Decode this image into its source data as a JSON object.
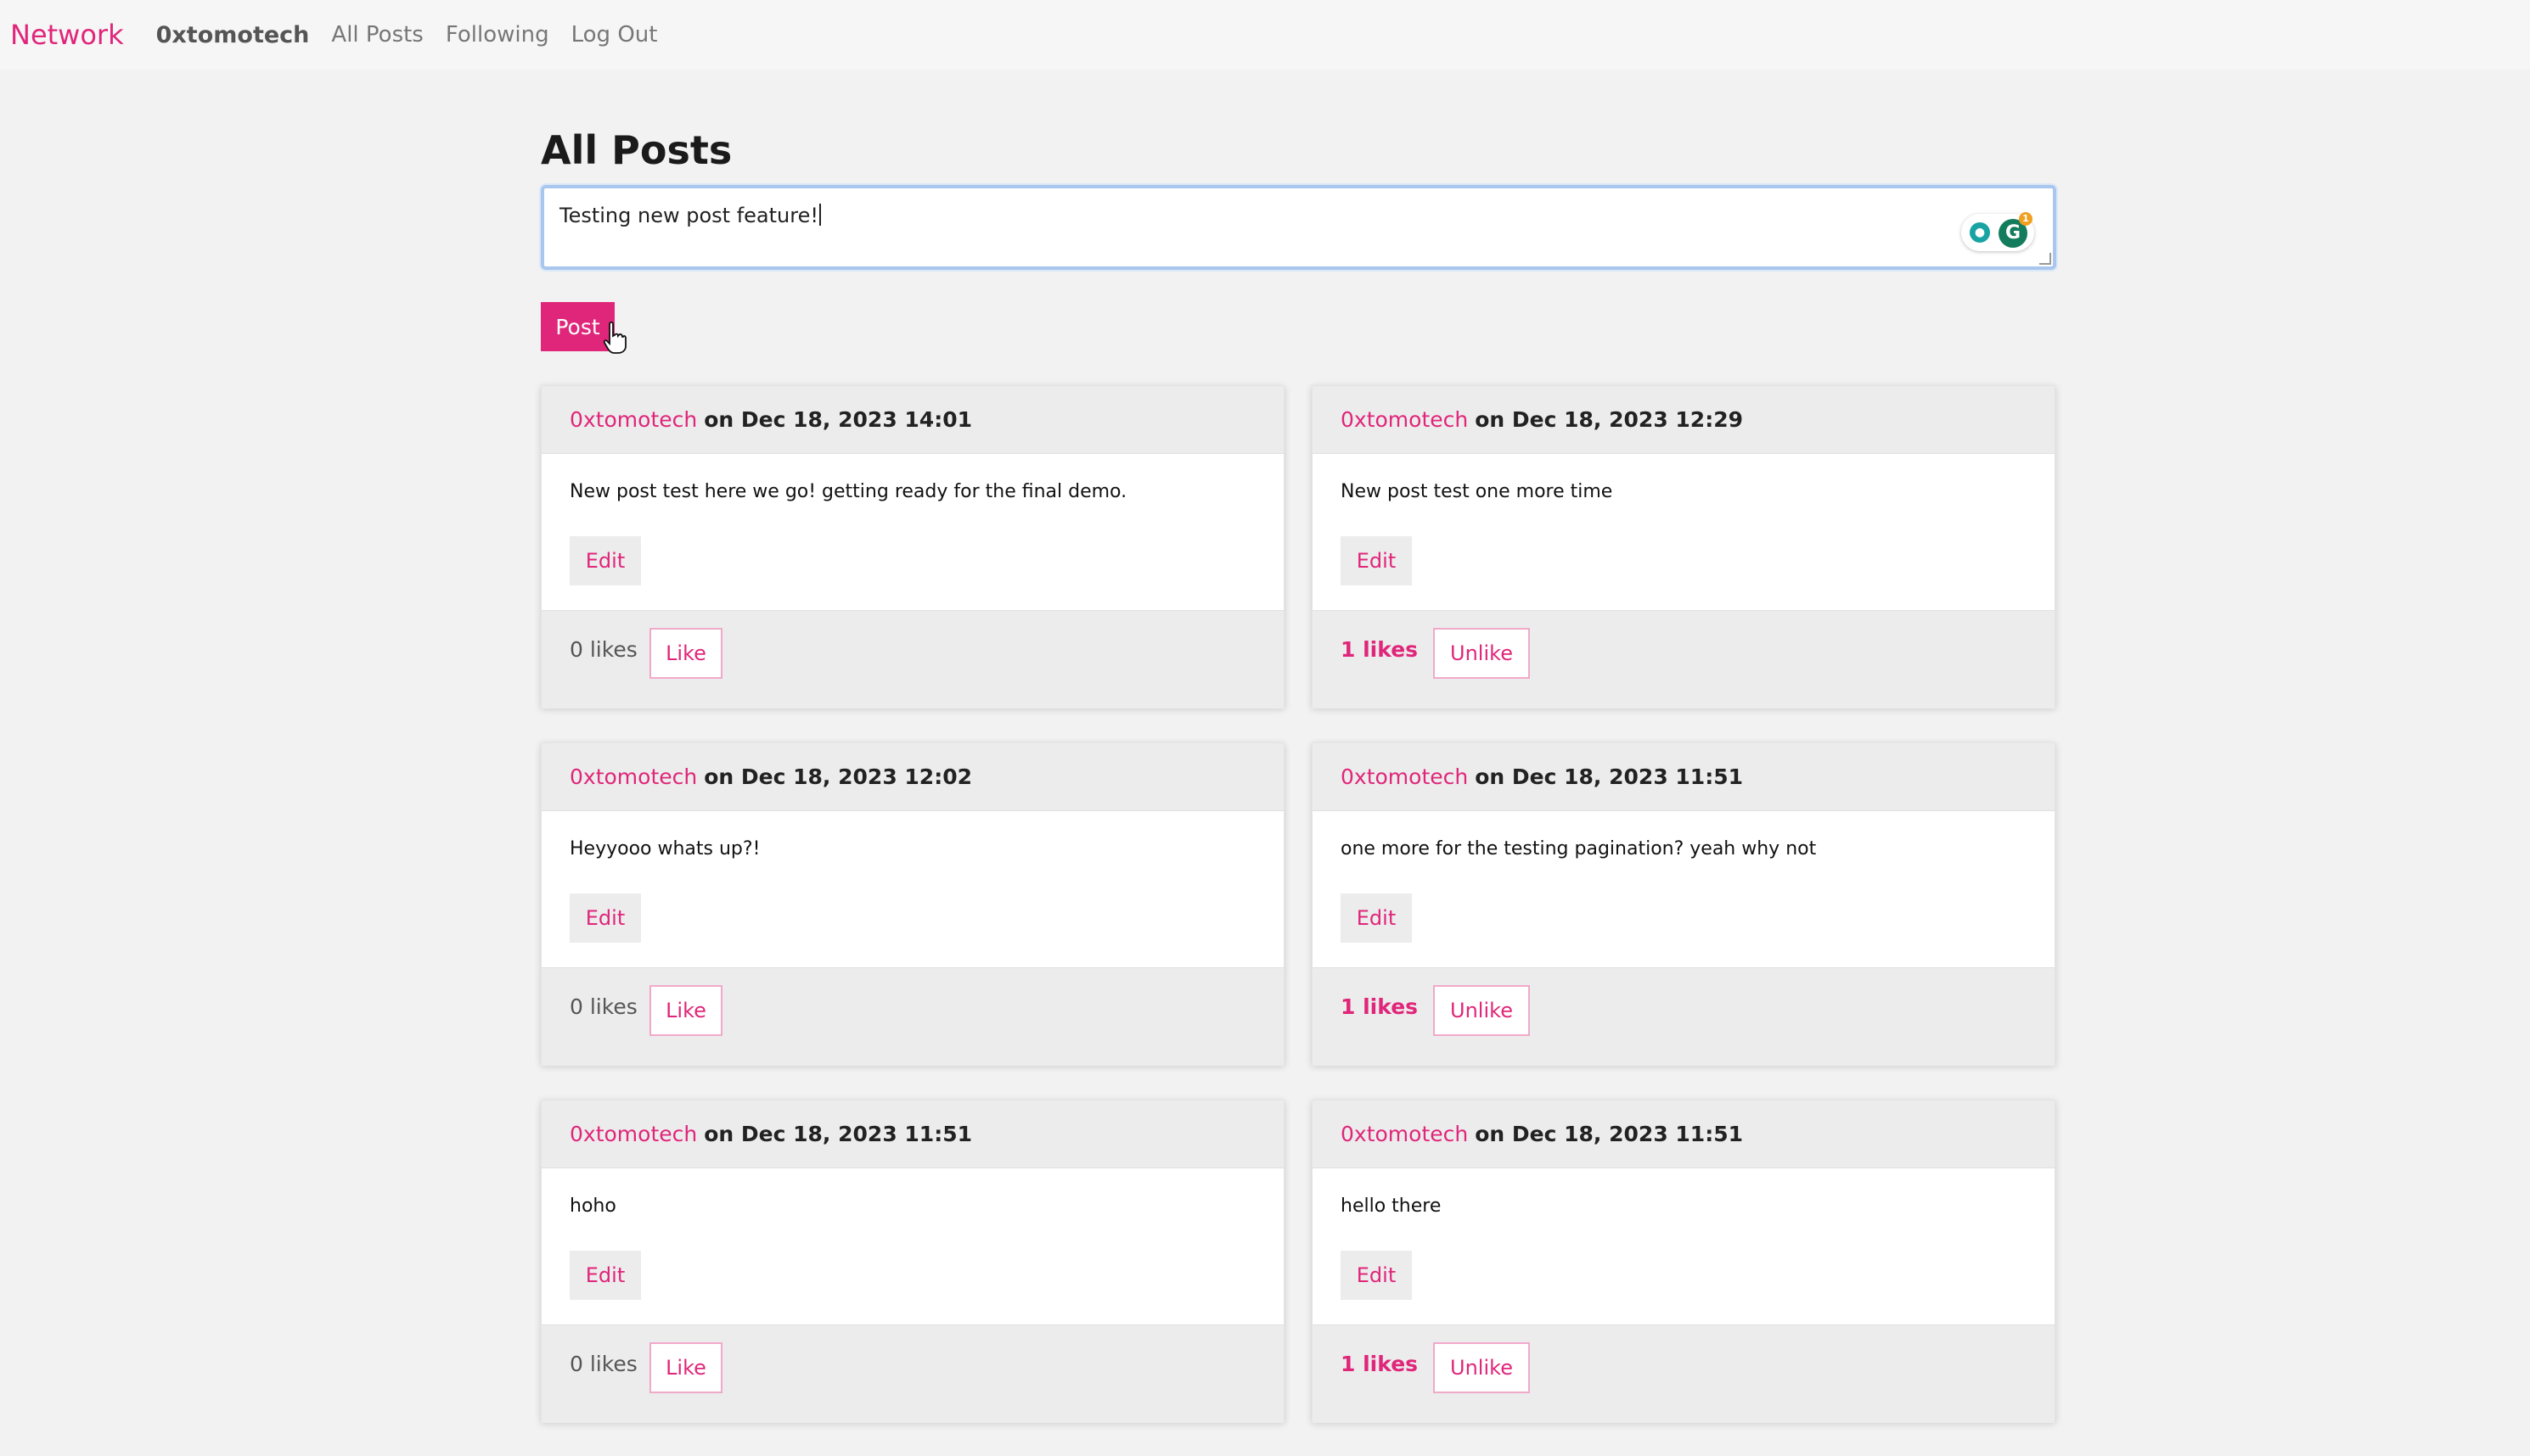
{
  "nav": {
    "brand": "Network",
    "username": "0xtomotech",
    "links": [
      "All Posts",
      "Following",
      "Log Out"
    ]
  },
  "page": {
    "title": "All Posts"
  },
  "composer": {
    "value": "Testing new post feature!",
    "badge_count": "1",
    "post_label": "Post"
  },
  "colors": {
    "accent": "#e0267a",
    "background": "#f2f2f2"
  },
  "posts": [
    {
      "author": "0xtomotech",
      "timestamp": "on Dec 18, 2023 14:01",
      "content": "New post test here we go! getting ready for the final demo.",
      "edit_label": "Edit",
      "likes": "0 likes",
      "liked": false,
      "like_label": "Like"
    },
    {
      "author": "0xtomotech",
      "timestamp": "on Dec 18, 2023 12:29",
      "content": "New post test one more time",
      "edit_label": "Edit",
      "likes": "1 likes",
      "liked": true,
      "like_label": "Unlike"
    },
    {
      "author": "0xtomotech",
      "timestamp": "on Dec 18, 2023 12:02",
      "content": "Heyyooo whats up?!",
      "edit_label": "Edit",
      "likes": "0 likes",
      "liked": false,
      "like_label": "Like"
    },
    {
      "author": "0xtomotech",
      "timestamp": "on Dec 18, 2023 11:51",
      "content": "one more for the testing pagination? yeah why not",
      "edit_label": "Edit",
      "likes": "1 likes",
      "liked": true,
      "like_label": "Unlike"
    },
    {
      "author": "0xtomotech",
      "timestamp": "on Dec 18, 2023 11:51",
      "content": "hoho",
      "edit_label": "Edit",
      "likes": "0 likes",
      "liked": false,
      "like_label": "Like"
    },
    {
      "author": "0xtomotech",
      "timestamp": "on Dec 18, 2023 11:51",
      "content": "hello there",
      "edit_label": "Edit",
      "likes": "1 likes",
      "liked": true,
      "like_label": "Unlike"
    }
  ]
}
